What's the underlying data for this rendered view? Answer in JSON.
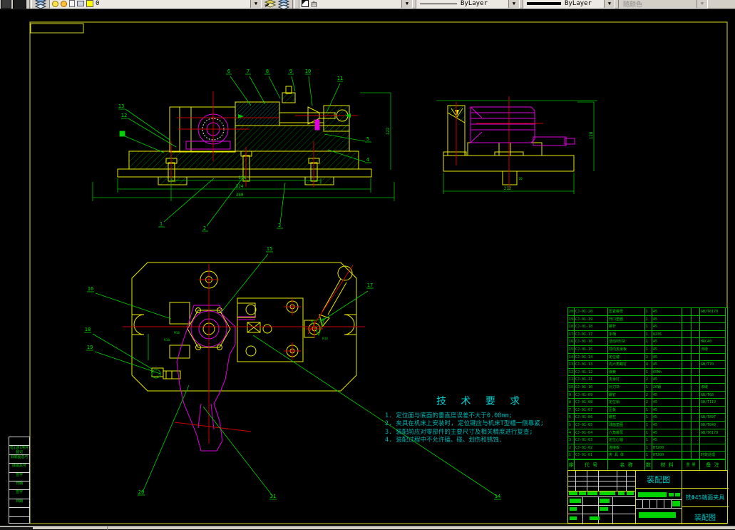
{
  "toolbar": {
    "layer_combo": {
      "current_layer": "0"
    },
    "color_combo": {
      "value": "白"
    },
    "linetype_combo": {
      "value": "ByLayer"
    },
    "lineweight_combo": {
      "value": "ByLayer"
    },
    "plotstyle_combo": {
      "value": "随颜色"
    }
  },
  "tech_requirements": {
    "title": "技 术 要 求",
    "items": [
      "1. 定位面与底面的垂直度误差不大于0.08mm;",
      "2. 夹具在机床上安装时, 定位键应与机床T型槽一侧靠紧;",
      "3. 装配前应对零部件的主要尺寸及相关精度进行复查;",
      "4. 装配过程中不允许磕、碰、划伤和锈蚀."
    ]
  },
  "views": {
    "front": {
      "dims": [
        "238",
        "324",
        "380",
        "122"
      ]
    },
    "side": {
      "dims": [
        "212",
        "128",
        "20"
      ]
    },
    "plan": {
      "labels": [
        "R10",
        "M10",
        "R10"
      ]
    }
  },
  "balloons": {
    "front_top": [
      "6",
      "7",
      "8",
      "9",
      "10"
    ],
    "front_right_top": "11",
    "front_left": [
      "13",
      "12"
    ],
    "front_right": [
      "5",
      "4"
    ],
    "front_bottom": [
      "1",
      "2",
      "3"
    ],
    "plan": [
      "15",
      "16",
      "17",
      "18",
      "19"
    ],
    "plan_bottom": [
      "20",
      "21",
      "14"
    ]
  },
  "margin_table": {
    "rows": [
      "",
      "借(通)用件登记",
      "旧底图总号",
      "底图总号",
      "签字",
      "日期",
      "签字",
      "日期",
      ""
    ]
  },
  "parts_table": {
    "headers": [
      "序",
      "代 号",
      "名 称",
      "数",
      "材 料",
      "重 量",
      "备 注"
    ],
    "rows": [
      {
        "no": "20",
        "code": "CJ-01-20",
        "name": "压紧螺母",
        "qty": "1",
        "mtl": "45",
        "note": "GB/T6170"
      },
      {
        "no": "19",
        "code": "CJ-01-19",
        "name": "开口垫圈",
        "qty": "1",
        "mtl": "45",
        "note": ""
      },
      {
        "no": "18",
        "code": "CJ-01-18",
        "name": "螺杆",
        "qty": "1",
        "mtl": "45",
        "note": ""
      },
      {
        "no": "17",
        "code": "CJ-01-17",
        "name": "手柄",
        "qty": "1",
        "mtl": "Q235",
        "note": ""
      },
      {
        "no": "16",
        "code": "CJ-01-16",
        "name": "活动V形块",
        "qty": "1",
        "mtl": "45",
        "note": "HRC40"
      },
      {
        "no": "15",
        "code": "CJ-01-15",
        "name": "导向支承板",
        "qty": "1",
        "mtl": "45",
        "note": "淬硬"
      },
      {
        "no": "14",
        "code": "CJ-01-14",
        "name": "定位键",
        "qty": "2",
        "mtl": "45",
        "note": ""
      },
      {
        "no": "13",
        "code": "CJ-01-13",
        "name": "内六角螺钉",
        "qty": "4",
        "mtl": "45",
        "note": "GB/T70"
      },
      {
        "no": "12",
        "code": "CJ-01-12",
        "name": "弹簧",
        "qty": "1",
        "mtl": "65Mn",
        "note": ""
      },
      {
        "no": "11",
        "code": "CJ-01-11",
        "name": "支承钉",
        "qty": "2",
        "mtl": "45",
        "note": ""
      },
      {
        "no": "10",
        "code": "CJ-01-10",
        "name": "对刀块",
        "qty": "1",
        "mtl": "20钢",
        "note": "渗碳"
      },
      {
        "no": "9",
        "code": "CJ-01-09",
        "name": "螺钉",
        "qty": "2",
        "mtl": "45",
        "note": "GB/T68"
      },
      {
        "no": "8",
        "code": "CJ-01-08",
        "name": "定位销",
        "qty": "2",
        "mtl": "45",
        "note": "GB/T119"
      },
      {
        "no": "7",
        "code": "CJ-01-07",
        "name": "压板",
        "qty": "1",
        "mtl": "45",
        "note": ""
      },
      {
        "no": "6",
        "code": "CJ-01-06",
        "name": "螺柱",
        "qty": "1",
        "mtl": "45",
        "note": "GB/T897"
      },
      {
        "no": "5",
        "code": "CJ-01-05",
        "name": "球面垫圈",
        "qty": "1",
        "mtl": "45",
        "note": "GB/T849"
      },
      {
        "no": "4",
        "code": "CJ-01-04",
        "name": "六角螺母",
        "qty": "1",
        "mtl": "45",
        "note": "GB/T6170"
      },
      {
        "no": "3",
        "code": "CJ-01-03",
        "name": "定位心轴",
        "qty": "1",
        "mtl": "45",
        "note": ""
      },
      {
        "no": "2",
        "code": "CJ-01-02",
        "name": "连接板",
        "qty": "1",
        "mtl": "HT200",
        "note": ""
      },
      {
        "no": "1",
        "code": "CJ-01-01",
        "name": "夹 具 体",
        "qty": "1",
        "mtl": "HT200",
        "note": "时效处理"
      }
    ]
  },
  "title_block": {
    "drawing_name": "装配图",
    "product_name": "铣Φ45端面夹具",
    "sheet_name": "装配图"
  }
}
